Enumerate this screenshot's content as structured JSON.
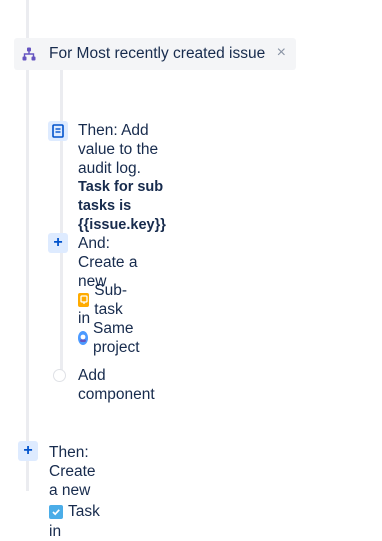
{
  "branch": {
    "label": "For Most recently created issue",
    "close_glyph": "×",
    "icon": "branch-icon"
  },
  "steps": {
    "audit": {
      "line1": "Then: Add value to the",
      "line2": "audit log.",
      "detail": "Task for sub tasks is {{issue.key}}",
      "icon": "audit-log-icon"
    },
    "create_subtask": {
      "title": "And: Create a new",
      "issue_type": "Sub-task",
      "in_label": "in",
      "project": "Same project",
      "icon": "plus-icon"
    },
    "add_component": {
      "label": "Add component"
    },
    "create_task": {
      "title": "Then: Create a new",
      "issue_type": "Task",
      "in_label": "in",
      "icon": "plus-icon"
    }
  },
  "colors": {
    "accent": "#0052cc",
    "icon_bg": "#deebff",
    "branch_bg": "#f4f5f7",
    "line": "#ebecf0",
    "subtask": "#ffab00",
    "task": "#4bade8"
  }
}
